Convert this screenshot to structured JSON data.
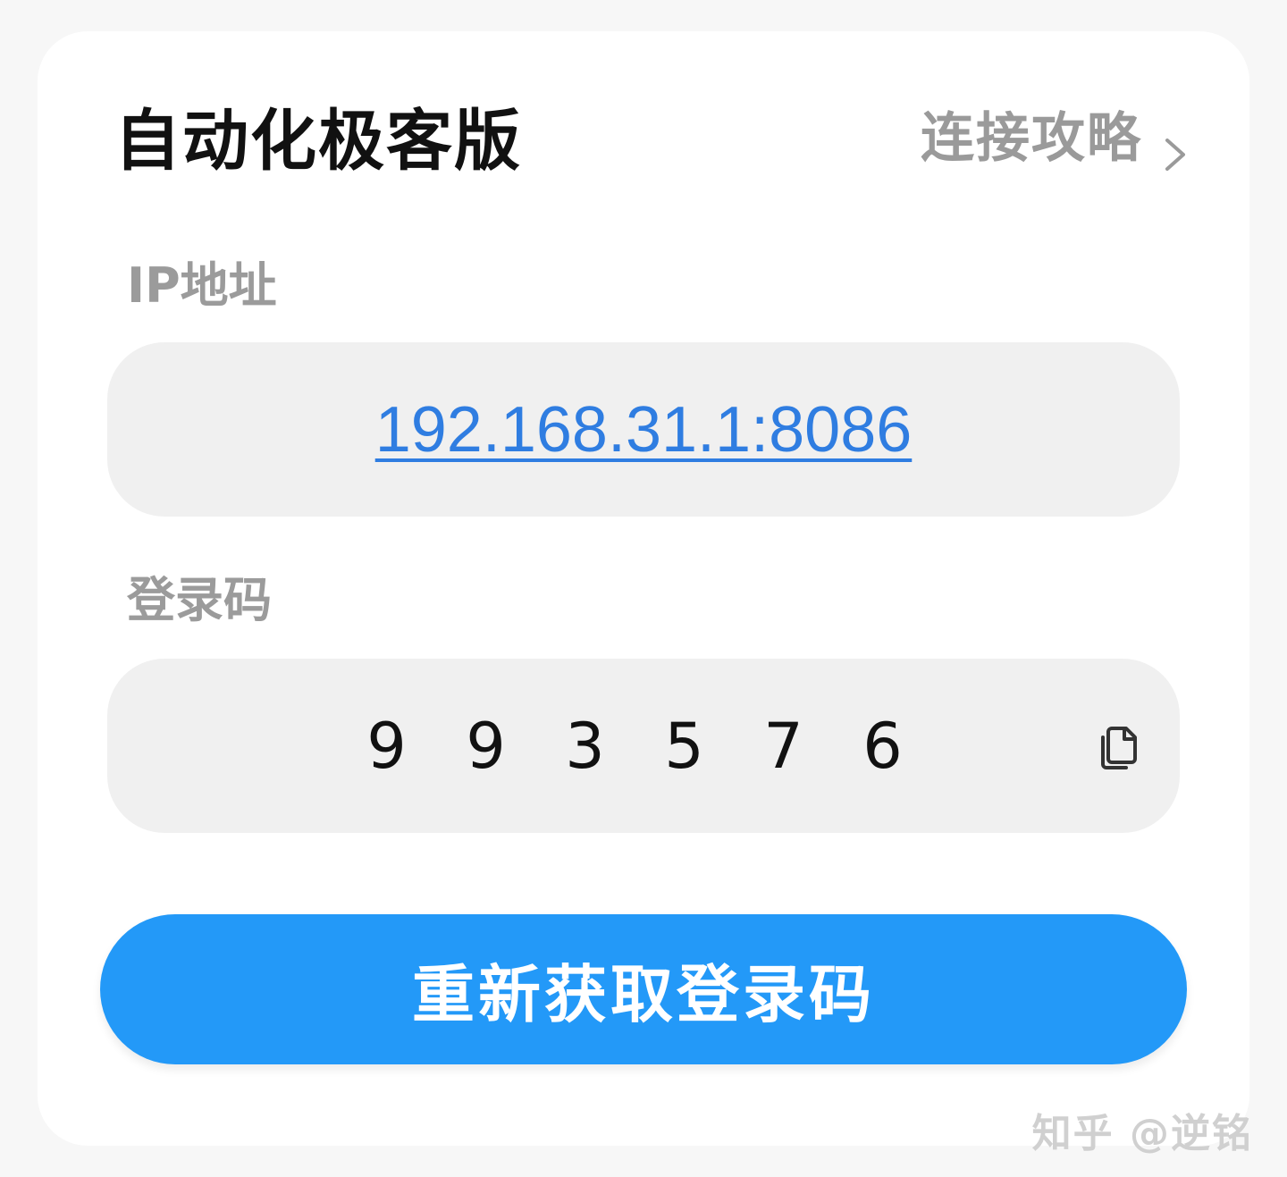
{
  "header": {
    "title": "自动化极客版",
    "guide_label": "连接攻略",
    "guide_icon": "chevron-right-icon"
  },
  "ip_section": {
    "label": "IP地址",
    "value": "192.168.31.1:8086"
  },
  "code_section": {
    "label": "登录码",
    "digits": [
      "9",
      "9",
      "3",
      "5",
      "7",
      "6"
    ],
    "copy_icon": "copy-icon"
  },
  "actions": {
    "refresh_label": "重新获取登录码"
  },
  "watermark": "知乎 @逆铭",
  "colors": {
    "accent": "#2399f8",
    "link": "#2f7de1",
    "field_bg": "#f0f0f0",
    "muted_text": "#9b9b9b"
  }
}
